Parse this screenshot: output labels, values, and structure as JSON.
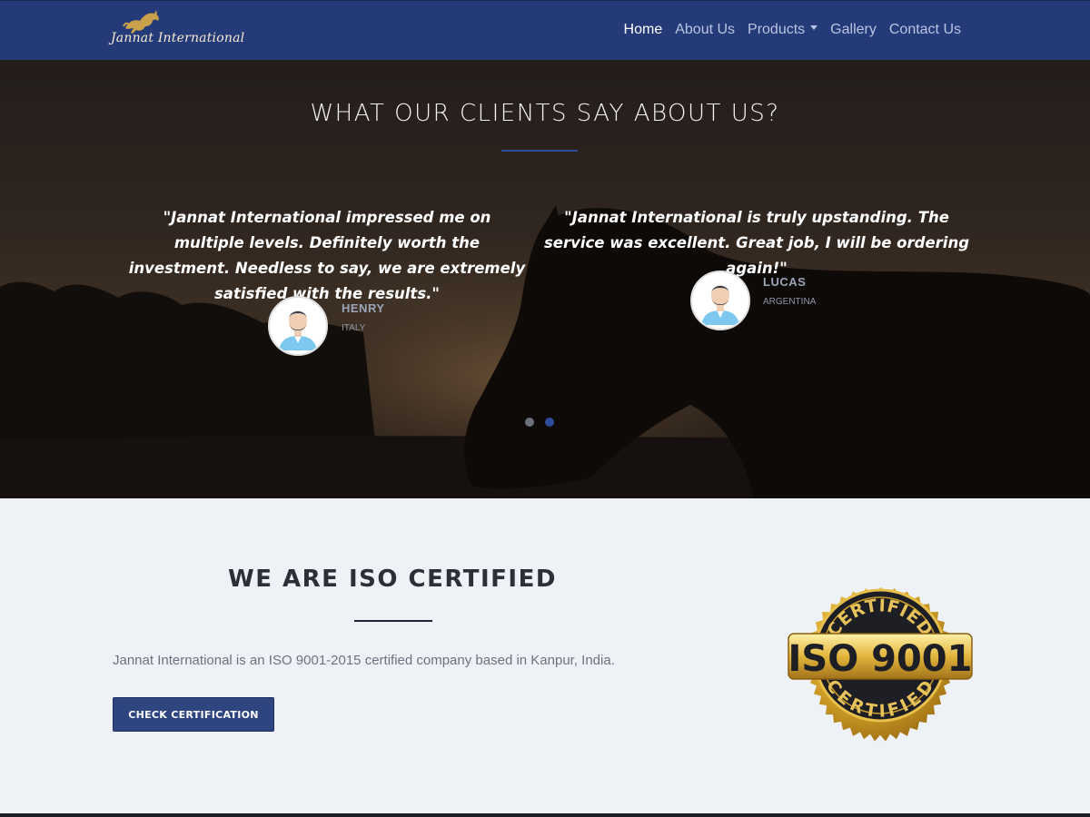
{
  "navbar": {
    "brand": "Jannat International",
    "items": [
      {
        "label": "Home",
        "active": true
      },
      {
        "label": "About Us",
        "active": false
      },
      {
        "label": "Products",
        "active": false,
        "dropdown": true
      },
      {
        "label": "Gallery",
        "active": false
      },
      {
        "label": "Contact Us",
        "active": false
      }
    ]
  },
  "testimonials": {
    "title": "WHAT OUR CLIENTS SAY ABOUT US?",
    "items": [
      {
        "quote": "\"Jannat International impressed me on multiple levels. Definitely worth the investment. Needless to say, we are extremely satisfied with the results.\"",
        "name": "HENRY",
        "country": "ITALY"
      },
      {
        "quote": "\"Jannat International is truly upstanding. The service was excellent. Great job, I will be ordering again!\"",
        "name": "LUCAS",
        "country": "ARGENTINA"
      }
    ],
    "active_slide": 2,
    "slide_count": 2
  },
  "iso": {
    "title": "WE ARE ISO CERTIFIED",
    "text": "Jannat International is an ISO 9001-2015 certified company based in Kanpur, India.",
    "button": "CHECK CERTIFICATION",
    "seal_top": "CERTIFIED",
    "seal_main": "ISO 9001",
    "seal_bottom": "CERTIFIED"
  },
  "colors": {
    "navbar": "#253a78",
    "accent": "#2d4c9a",
    "button": "#2f4580",
    "section_bg": "#eef2f7",
    "gold": "#d4a62a"
  }
}
